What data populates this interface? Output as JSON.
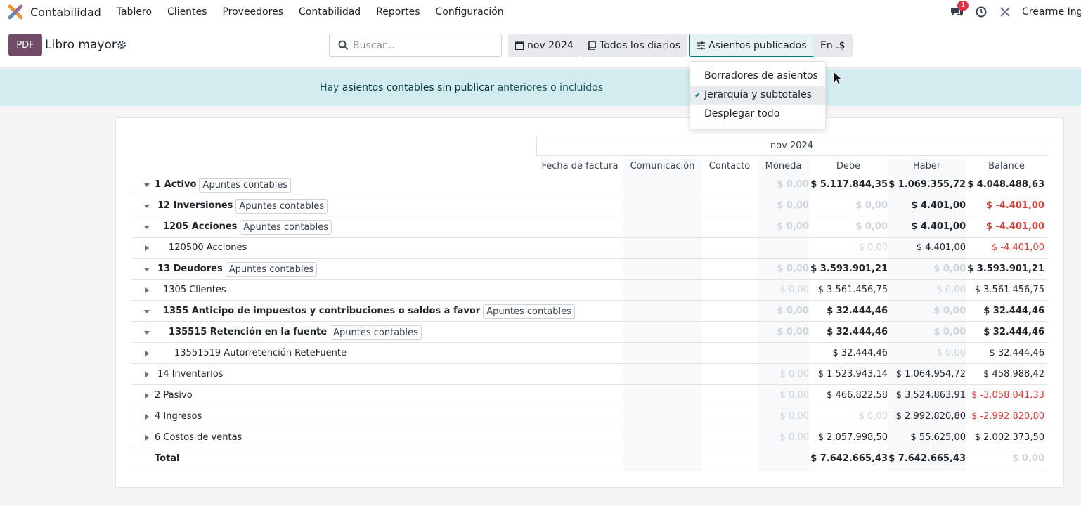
{
  "navbar": {
    "app_name": "Contabilidad",
    "menu": [
      "Tablero",
      "Clientes",
      "Proveedores",
      "Contabilidad",
      "Reportes",
      "Configuración"
    ],
    "badge_count": "1",
    "user": "Crearme Ing"
  },
  "control": {
    "pdf_label": "PDF",
    "title": "Libro mayor",
    "search_placeholder": "Buscar...",
    "date_filter": "nov 2024",
    "journals_filter": "Todos los diarios",
    "posted_filter": "Asientos publicados",
    "currency_filter": "En .$"
  },
  "banner": {
    "prefix": "Hay ",
    "link": "asientos contables sin publicar",
    "suffix": " anteriores o incluidos"
  },
  "dropdown": {
    "items": [
      {
        "label": "Borradores de asientos",
        "checked": false
      },
      {
        "label": "Jerarquía y subtotales",
        "checked": true
      },
      {
        "label": "Desplegar todo",
        "checked": false
      }
    ]
  },
  "report": {
    "period": "nov 2024",
    "columns": [
      "Fecha de factura",
      "Comunicación",
      "Contacto",
      "Moneda",
      "Debe",
      "Haber",
      "Balance"
    ],
    "tag_label": "Apuntes contables",
    "rows": [
      {
        "label": "1 Activo",
        "level": 0,
        "bold": true,
        "tag": true,
        "open": true,
        "moneda": "$ 0,00",
        "debe": "$ 5.117.844,35",
        "haber": "$ 1.069.355,72",
        "balance": "$ 4.048.488,63"
      },
      {
        "label": "12 Inversiones",
        "level": 1,
        "bold": true,
        "tag": true,
        "open": true,
        "moneda": "$ 0,00",
        "debe": "$ 0,00",
        "haber": "$ 4.401,00",
        "balance": "$ -4.401,00"
      },
      {
        "label": "1205 Acciones",
        "level": 2,
        "bold": true,
        "tag": true,
        "open": true,
        "moneda": "$ 0,00",
        "debe": "$ 0,00",
        "haber": "$ 4.401,00",
        "balance": "$ -4.401,00"
      },
      {
        "label": "120500 Acciones",
        "level": 3,
        "bold": false,
        "tag": false,
        "open": false,
        "moneda": "",
        "debe": "$ 0,00",
        "haber": "$ 4.401,00",
        "balance": "$ -4.401,00"
      },
      {
        "label": "13 Deudores",
        "level": 1,
        "bold": true,
        "tag": true,
        "open": true,
        "moneda": "$ 0,00",
        "debe": "$ 3.593.901,21",
        "haber": "$ 0,00",
        "balance": "$ 3.593.901,21"
      },
      {
        "label": "1305 Clientes",
        "level": 2,
        "bold": false,
        "tag": false,
        "open": false,
        "moneda": "$ 0,00",
        "debe": "$ 3.561.456,75",
        "haber": "$ 0,00",
        "balance": "$ 3.561.456,75"
      },
      {
        "label": "1355 Anticipo de impuestos y contribuciones o saldos a favor",
        "level": 2,
        "bold": true,
        "tag": true,
        "open": true,
        "moneda": "$ 0,00",
        "debe": "$ 32.444,46",
        "haber": "$ 0,00",
        "balance": "$ 32.444,46"
      },
      {
        "label": "135515 Retención en la fuente",
        "level": 3,
        "bold": true,
        "tag": true,
        "open": true,
        "moneda": "$ 0,00",
        "debe": "$ 32.444,46",
        "haber": "$ 0,00",
        "balance": "$ 32.444,46"
      },
      {
        "label": "13551519 Autorretención ReteFuente",
        "level": 4,
        "bold": false,
        "tag": false,
        "open": false,
        "moneda": "",
        "debe": "$ 32.444,46",
        "haber": "$ 0,00",
        "balance": "$ 32.444,46"
      },
      {
        "label": "14 Inventarios",
        "level": 1,
        "bold": false,
        "tag": false,
        "open": false,
        "moneda": "$ 0,00",
        "debe": "$ 1.523.943,14",
        "haber": "$ 1.064.954,72",
        "balance": "$ 458.988,42"
      },
      {
        "label": "2 Pasivo",
        "level": 0,
        "bold": false,
        "tag": false,
        "open": false,
        "moneda": "$ 0,00",
        "debe": "$ 466.822,58",
        "haber": "$ 3.524.863,91",
        "balance": "$ -3.058.041,33"
      },
      {
        "label": "4 Ingresos",
        "level": 0,
        "bold": false,
        "tag": false,
        "open": false,
        "moneda": "$ 0,00",
        "debe": "$ 0,00",
        "haber": "$ 2.992.820,80",
        "balance": "$ -2.992.820,80"
      },
      {
        "label": "6 Costos de ventas",
        "level": 0,
        "bold": false,
        "tag": false,
        "open": false,
        "moneda": "$ 0,00",
        "debe": "$ 2.057.998,50",
        "haber": "$ 55.625,00",
        "balance": "$ 2.002.373,50"
      },
      {
        "label": "Total",
        "level": 0,
        "bold": true,
        "tag": false,
        "open": null,
        "moneda": "",
        "debe": "$ 7.642.665,43",
        "haber": "$ 7.642.665,43",
        "balance": "$ 0,00"
      }
    ]
  },
  "colors": {
    "brand": "#714b67",
    "accent": "#017e84",
    "negative": "#d23f3a",
    "banner": "#d2ecef"
  }
}
